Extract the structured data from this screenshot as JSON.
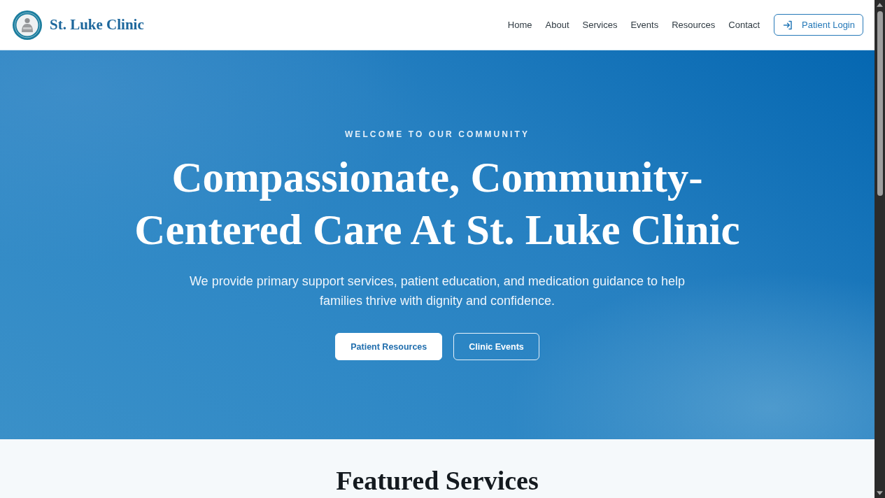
{
  "header": {
    "brand": "St. Luke Clinic",
    "nav": [
      {
        "label": "Home"
      },
      {
        "label": "About"
      },
      {
        "label": "Services"
      },
      {
        "label": "Events"
      },
      {
        "label": "Resources"
      },
      {
        "label": "Contact"
      }
    ],
    "login_button": "Patient Login"
  },
  "hero": {
    "eyebrow": "WELCOME TO OUR COMMUNITY",
    "title": "Compassionate, Community-Centered Care At St. Luke Clinic",
    "lead": "We provide primary support services, patient education, and medication guidance to help families thrive with dignity and confidence.",
    "buttons": [
      {
        "label": "Patient Resources",
        "kind": "primary"
      },
      {
        "label": "Clinic Events",
        "kind": "outline"
      }
    ]
  },
  "featured": {
    "heading": "Featured Services"
  }
}
